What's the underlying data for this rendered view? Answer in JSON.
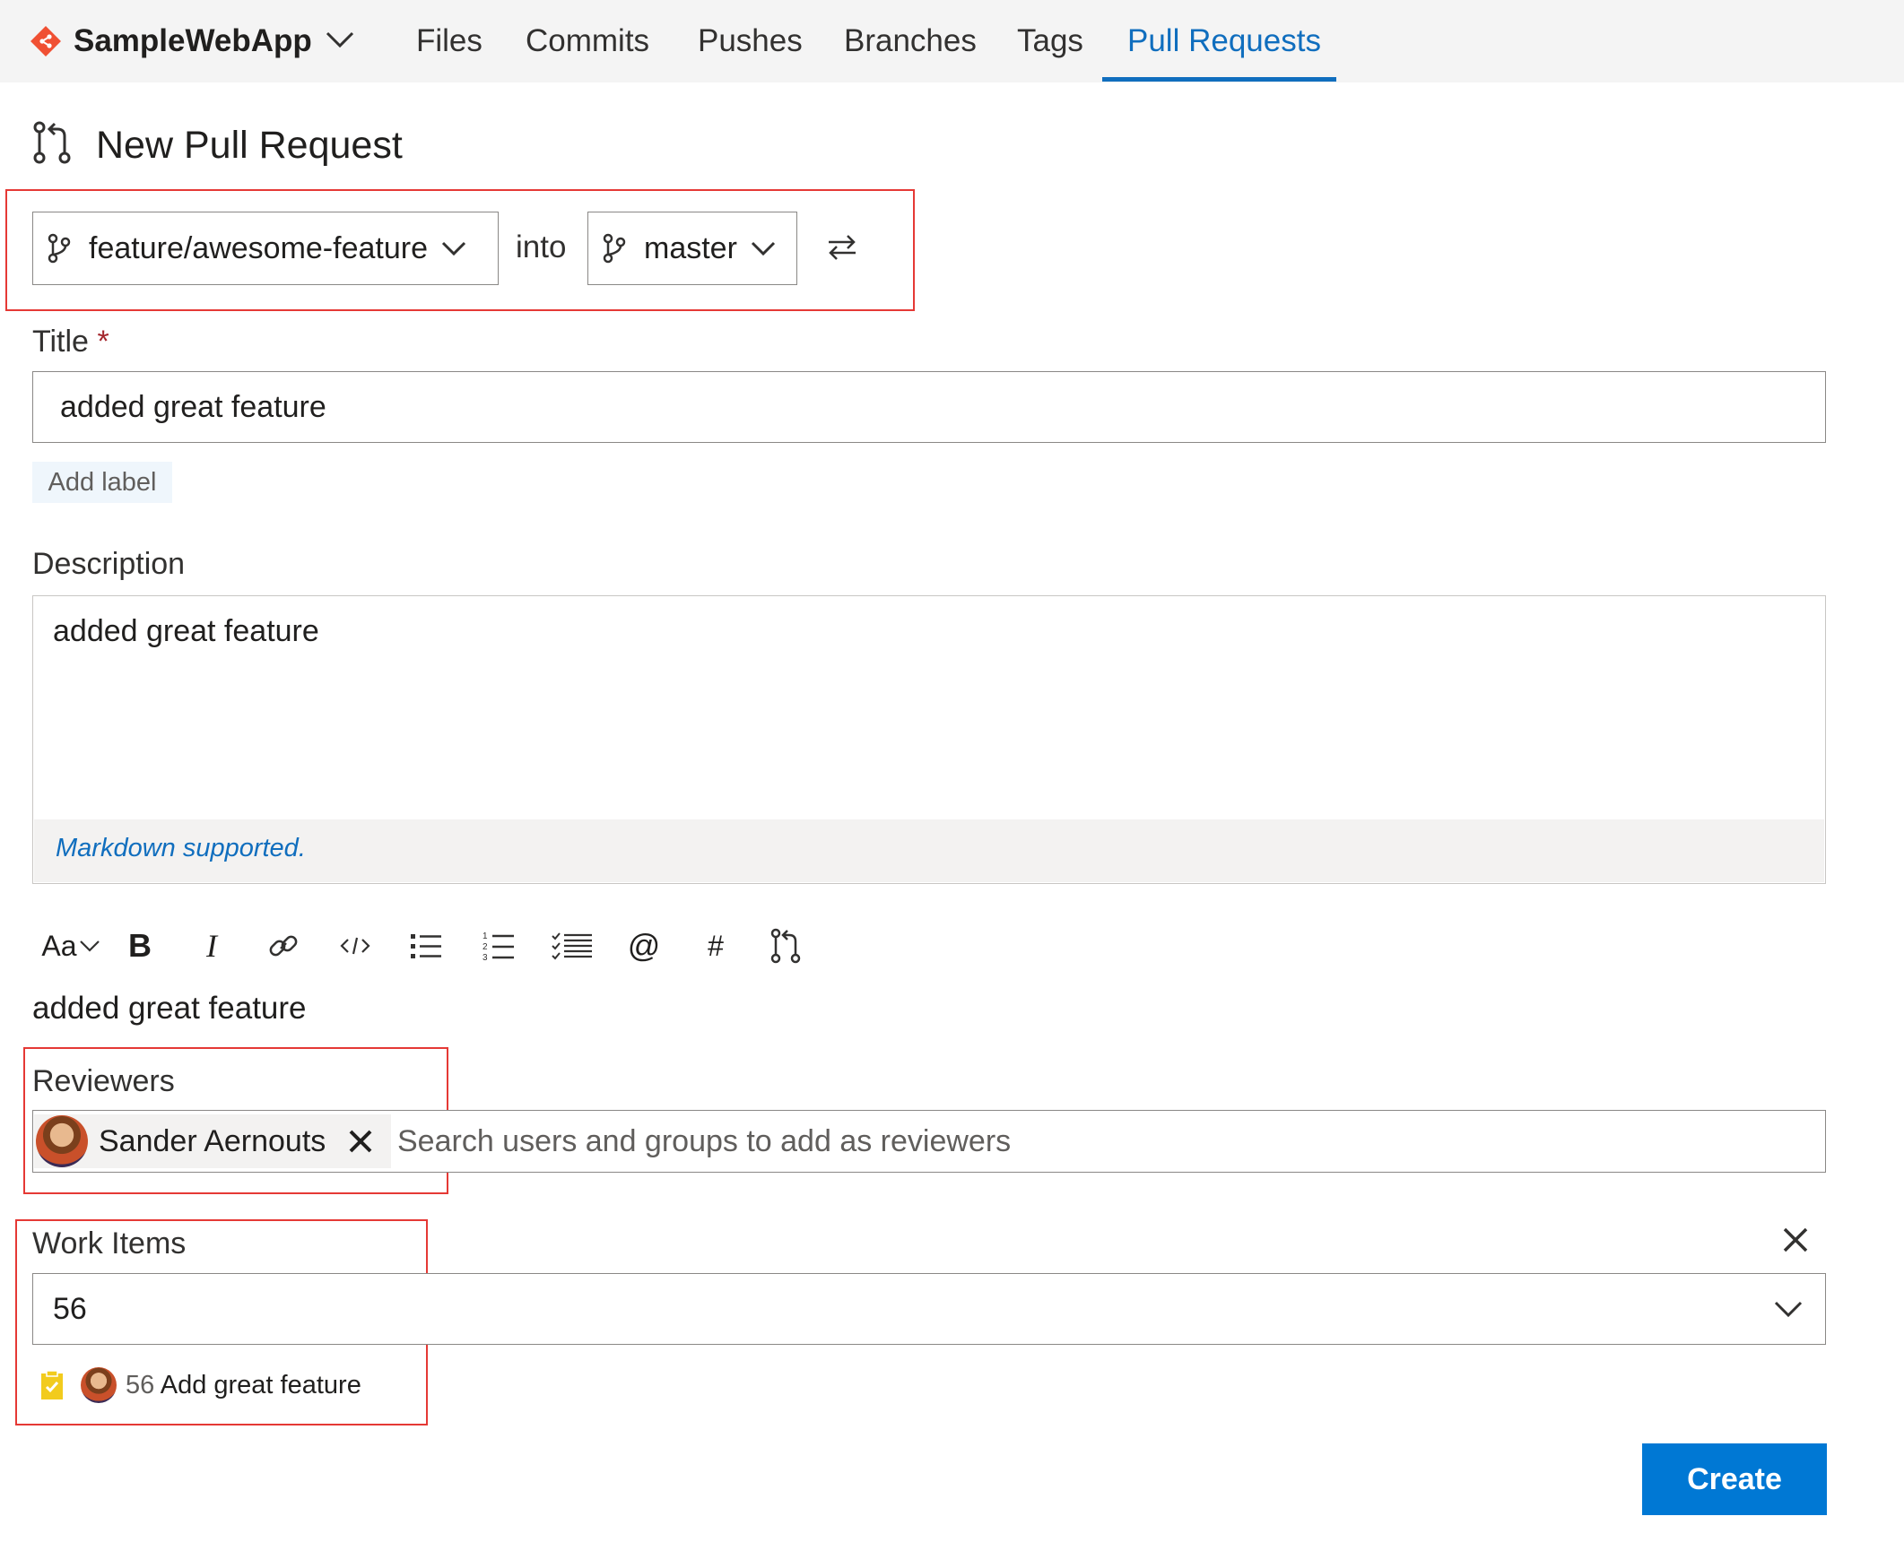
{
  "header": {
    "repo_name": "SampleWebApp",
    "nav": [
      "Files",
      "Commits",
      "Pushes",
      "Branches",
      "Tags",
      "Pull Requests"
    ],
    "active_tab": "Pull Requests"
  },
  "page": {
    "title": "New Pull Request"
  },
  "branches": {
    "source": "feature/awesome-feature",
    "into_label": "into",
    "target": "master"
  },
  "title_field": {
    "label": "Title",
    "required_marker": "*",
    "value": "added great feature",
    "add_label": "Add label"
  },
  "description": {
    "label": "Description",
    "value": "added great feature",
    "footer": "Markdown supported."
  },
  "toolbar": {
    "buttons": [
      "Aa",
      "B",
      "I",
      "link-icon",
      "code-icon",
      "bulleted-list-icon",
      "numbered-list-icon",
      "task-list-icon",
      "@",
      "#",
      "pull-request-icon"
    ]
  },
  "preview": {
    "text": "added great feature"
  },
  "reviewers": {
    "label": "Reviewers",
    "selected": "Sander Aernouts",
    "placeholder": "Search users and groups to add as reviewers"
  },
  "work_items": {
    "label": "Work Items",
    "value": "56",
    "item_id": "56",
    "item_title": "Add great feature"
  },
  "actions": {
    "create": "Create"
  },
  "colors": {
    "accent": "#0078d4",
    "link": "#106ebe",
    "highlight_box": "#e53935",
    "git_logo": "#f05033"
  }
}
